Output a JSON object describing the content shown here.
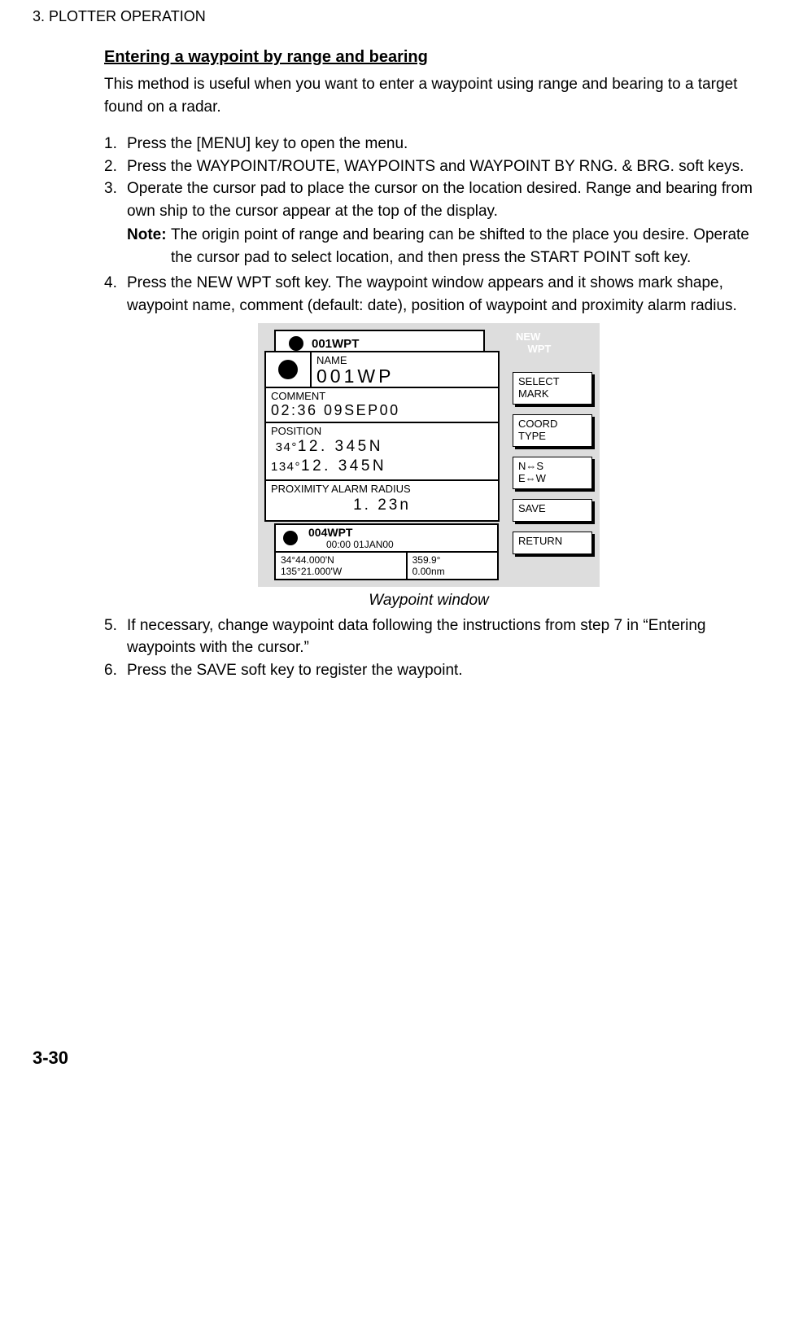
{
  "header": "3. PLOTTER OPERATION",
  "section_title": "Entering a waypoint by range and bearing",
  "intro": "This method is useful when you want to enter a waypoint using range and bearing to a target found on a radar.",
  "steps": {
    "s1": {
      "num": "1.",
      "body": "Press the [MENU] key to open the menu."
    },
    "s2": {
      "num": "2.",
      "body": "Press the WAYPOINT/ROUTE, WAYPOINTS and WAYPOINT BY RNG. & BRG. soft keys."
    },
    "s3": {
      "num": "3.",
      "body": "Operate the cursor pad to place the cursor on the location desired. Range and bearing from own ship to the cursor appear at the top of the display."
    },
    "note": {
      "label": "Note:",
      "body": "The origin point of range and bearing can be shifted to the place you desire. Operate the cursor pad to select location, and then press the START POINT soft key."
    },
    "s4": {
      "num": "4.",
      "body": "Press the NEW WPT soft key. The waypoint window appears and it shows mark shape, waypoint name, comment (default: date), position of waypoint and proximity alarm radius."
    },
    "s5": {
      "num": "5.",
      "body": "If necessary, change waypoint data following the instructions from step 7 in “Entering waypoints with the cursor.”"
    },
    "s6": {
      "num": "6.",
      "body": "Press the SAVE soft key to register the waypoint."
    }
  },
  "diagram": {
    "back_label": "001WPT",
    "name_label": "NAME",
    "name_value": "001WP",
    "comment_label": "COMMENT",
    "comment_value": "02:36 09SEP00",
    "position_label": "POSITION",
    "position_line1_prefix": " 34°",
    "position_line1_main": "12. 345N",
    "position_line2_prefix": "134°",
    "position_line2_main": "12. 345N",
    "prox_label": "PROXIMITY ALARM RADIUS",
    "prox_value": "1. 23n",
    "bottom_name": "004WPT",
    "bottom_datetime": "00:00 01JAN00",
    "bottom_lat": "34°44.000'N",
    "bottom_lon": "135°21.000'W",
    "bottom_brg": "359.9°",
    "bottom_rng": "0.00nm",
    "softkeys": {
      "title1": "NEW",
      "title2": "    WPT",
      "k1a": "SELECT",
      "k1b": "MARK",
      "k2a": "COORD",
      "k2b": "TYPE",
      "k3a": "N⇔S",
      "k3b": "E⇔W",
      "k4": "SAVE",
      "k5": "RETURN"
    }
  },
  "caption": "Waypoint window",
  "page_number": "3-30"
}
